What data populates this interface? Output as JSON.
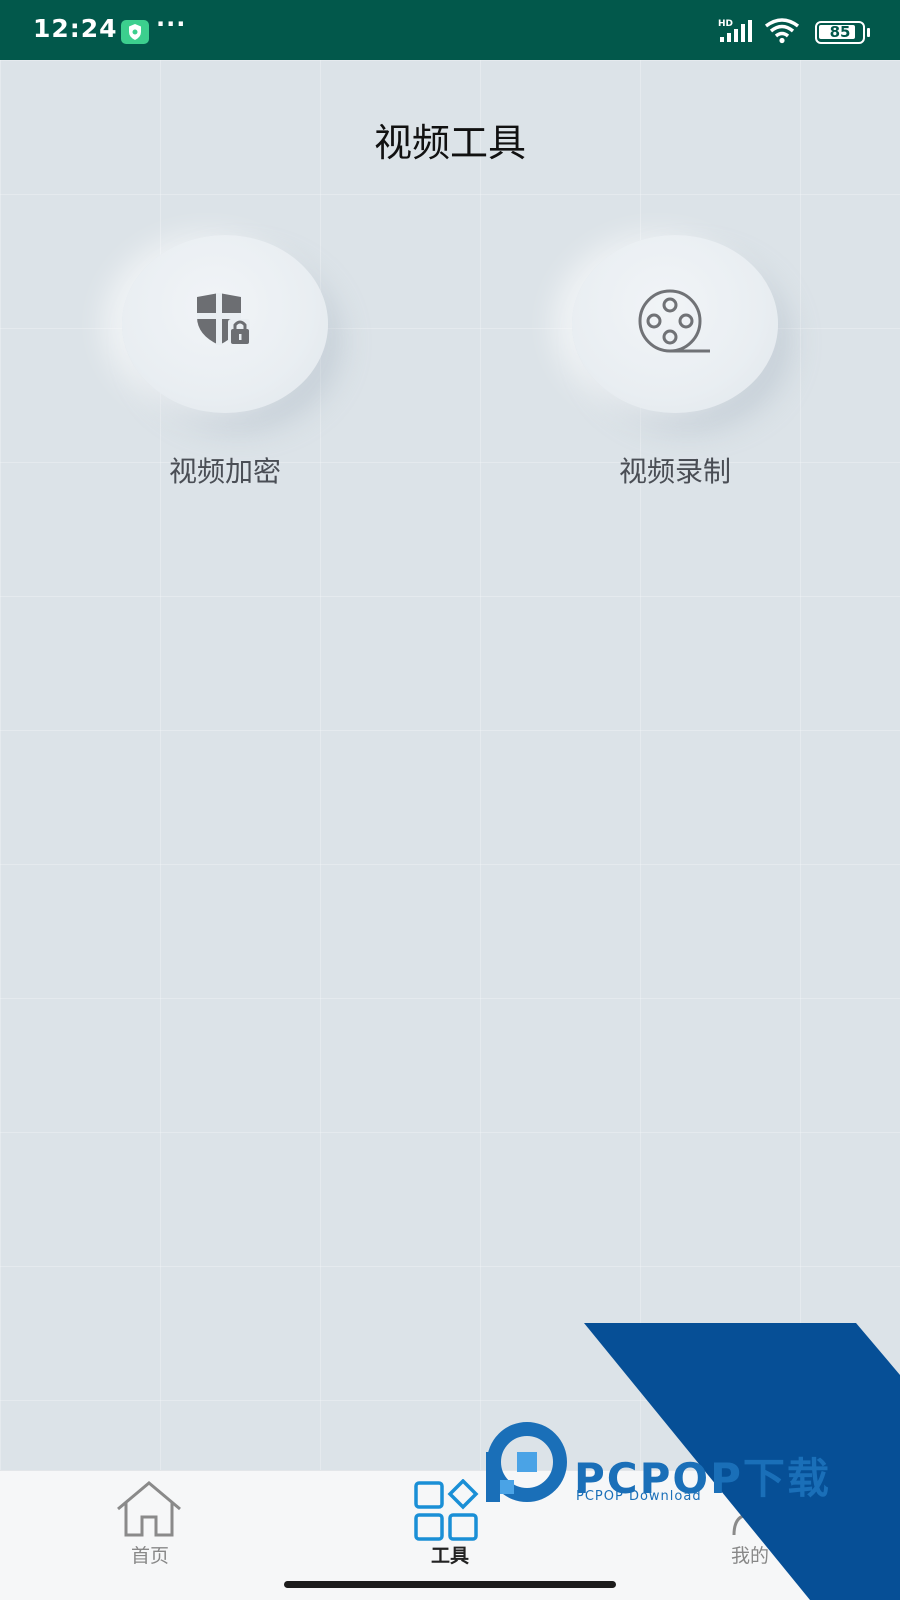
{
  "status_bar": {
    "time": "12:24",
    "dots": "···",
    "network_label": "HD",
    "battery_level": "85",
    "background_color": "#02584b"
  },
  "page": {
    "title": "视频工具"
  },
  "tools": [
    {
      "label": "视频加密",
      "icon": "shield-lock-icon"
    },
    {
      "label": "视频录制",
      "icon": "film-reel-icon"
    }
  ],
  "bottom_nav": {
    "items": [
      {
        "label": "首页",
        "icon": "home-icon",
        "active": false
      },
      {
        "label": "工具",
        "icon": "tools-grid-icon",
        "active": true
      },
      {
        "label": "我的",
        "icon": "profile-icon",
        "active": false
      }
    ],
    "accent_color": "#1a8fd6"
  },
  "watermark": {
    "brand": "PCPOP下载",
    "subtitle": "PCPOP Download"
  }
}
